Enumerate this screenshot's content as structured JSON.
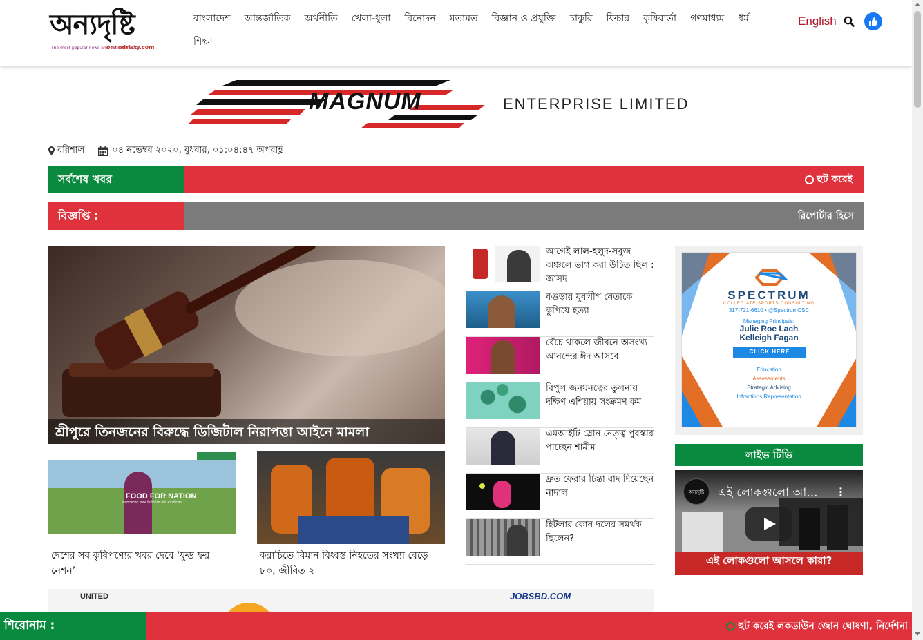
{
  "logo": {
    "text": "অন্যদৃষ্টি",
    "tagline": "The most popular news and education site",
    "url": "onnodristy.com"
  },
  "nav": {
    "items": [
      "বাংলাদেশ",
      "আন্তর্জাতিক",
      "অর্থনীতি",
      "খেলা-ধুলা",
      "বিনোদন",
      "মতামত",
      "বিজ্ঞান ও প্রযুক্তি",
      "চাকুরি",
      "ফিচার",
      "কৃষিবার্তা",
      "গণমাধ্যম",
      "ধর্ম",
      "শিক্ষা"
    ],
    "language": "English"
  },
  "banner": {
    "brand": "MAGNUM",
    "company": "ENTERPRISE LIMITED"
  },
  "dateline": {
    "location": "বরিশাল",
    "datetime": "০৪ নভেম্বর ২০২০, বুধবার, ০১:০৪:৪৭ অপরাহ্ণ"
  },
  "latest": {
    "label": "সর্বশেষ খবর",
    "text": "হুট করেই"
  },
  "notice": {
    "label": "বিজ্ঞপ্তি :",
    "text": "রিপোর্টার হিসে"
  },
  "hero": {
    "caption": "শ্রীপুরে তিনজনের বিরুদ্ধে ডিজিটাল নিরাপত্তা আইনে মামলা"
  },
  "cards": [
    {
      "title": "দেশের সব কৃষিপণ্যের খবর দেবে ‘ফুড ফর নেশন’",
      "image_text": "FOOD FOR NATION",
      "image_sub": "বাংলাদেশের প্রথম ডিজিটাল কৃষি মার্কেটপ্লেস"
    },
    {
      "title": "করাচিতে বিমান বিধ্বস্ত নিহতের সংখ্যা বেড়ে ৮০, জীবিত ২"
    }
  ],
  "side_news": [
    "আগেই লাল-হলুদ-সবুজ অঞ্চলে ভাগ করা উচিত ছিল : জাসদ",
    "বগুড়ায় যুবলীগ নেতাকে কুপিয়ে হত্যা",
    "বেঁচে থাকলে জীবনে অসংখ্য আনন্দের ঈদ আসবে",
    "বিপুল জনঘনত্বের তুলনায় দক্ষিণ এশিয়ায় সংক্রমণ কম",
    "এমআইটি স্লোন নেতৃত্ব পুরস্কার পাচ্ছেন শামীম",
    "দ্রুত ফেরার চিন্তা বাদ দিয়েছেন নাদাল",
    "হিটলার কোন দলের সমর্থক ছিলেন?"
  ],
  "spectrum_ad": {
    "name": "SPECTRUM",
    "sub": "COLLEGIATE SPORTS CONSULTING",
    "contact": "317-721-6610  •  @SpectrumCSC",
    "managing": "Managing Principals:",
    "principal_1": "Julie Roe Lach",
    "principal_2": "Kelleigh Fagan",
    "cta": "CLICK HERE",
    "services": [
      "Education",
      "Assessments",
      "Strategic Advising",
      "Infractions Representation"
    ]
  },
  "live_tv": {
    "label": "লাইভ টিভি",
    "channel": "অন্যদৃষ্টি",
    "video_title": "এই লোকগুলো আ...",
    "video_band": "এই লোকগুলো আসলে কারা?"
  },
  "bottom_ad": {
    "left": "UNITED",
    "right": "JOBSBD.COM"
  },
  "headline": {
    "label": "শিরোনাম :",
    "text": "হুট করেই লকডাউন জোন ঘোষণা, নির্দেশনা"
  },
  "colors": {
    "green": "#0a8a3e",
    "red": "#e0323d",
    "gray": "#7b7b7b",
    "link_red": "#b2182b",
    "facebook_blue": "#1877f2"
  }
}
